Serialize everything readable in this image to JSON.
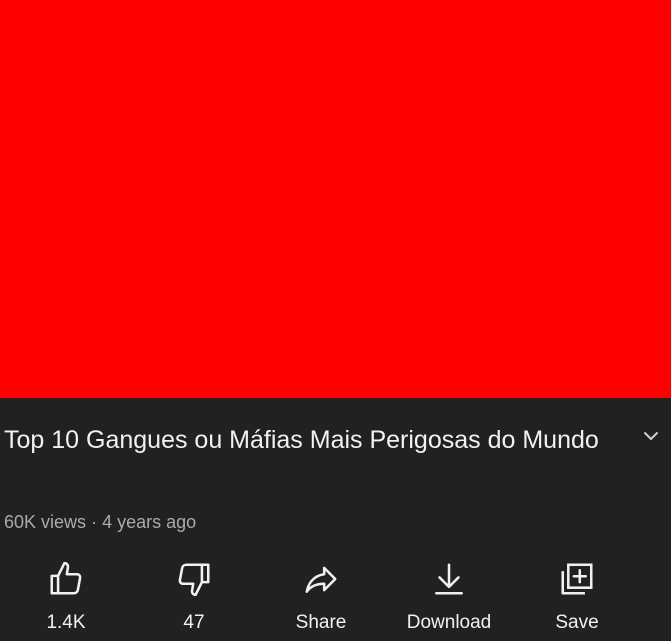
{
  "video": {
    "title": "Top 10 Gangues ou Máfias Mais Perigosas do Mundo",
    "views": "60K views",
    "separator": "·",
    "age": "4 years ago"
  },
  "actions": [
    {
      "id": "like",
      "label": "1.4K",
      "icon": "thumbs-up-icon"
    },
    {
      "id": "dislike",
      "label": "47",
      "icon": "thumbs-down-icon"
    },
    {
      "id": "share",
      "label": "Share",
      "icon": "share-icon"
    },
    {
      "id": "download",
      "label": "Download",
      "icon": "download-icon"
    },
    {
      "id": "save",
      "label": "Save",
      "icon": "add-to-playlist-icon"
    }
  ],
  "colors": {
    "player": "#ff0000",
    "background": "#212121",
    "text": "#f1f1f1",
    "secondary_text": "#aaaaaa"
  }
}
